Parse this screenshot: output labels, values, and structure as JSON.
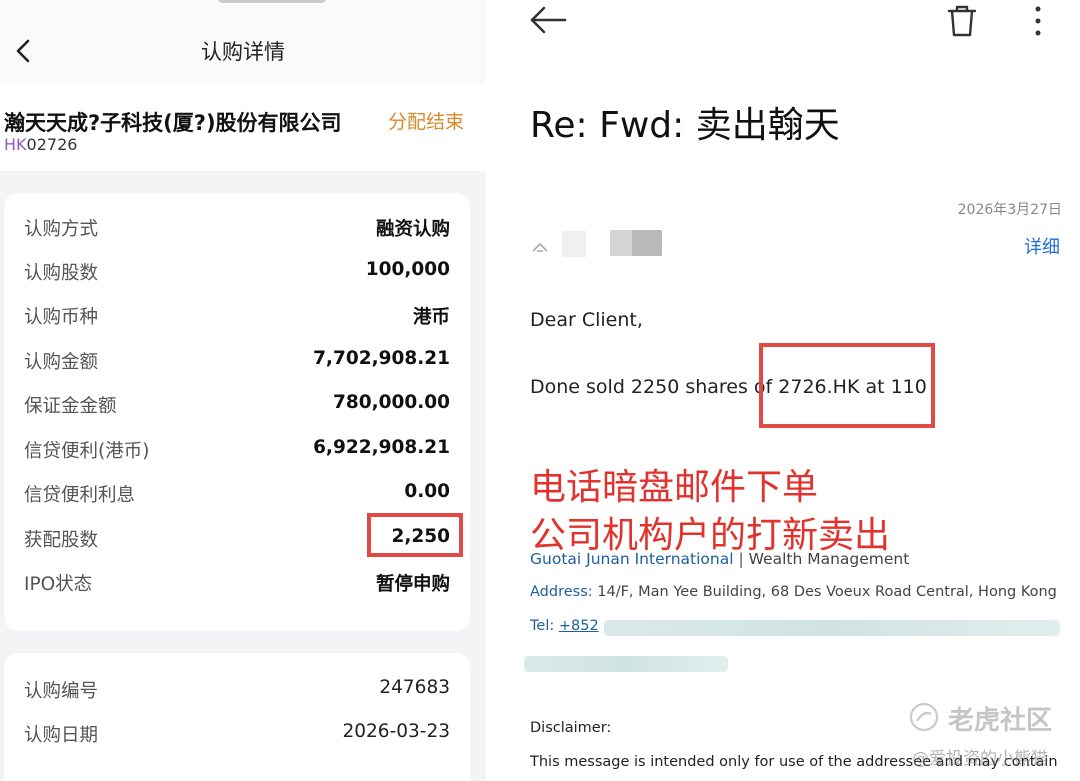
{
  "left": {
    "header_title": "认购详情",
    "stock_name": "瀚天天成?子科技(厦?)股份有限公司",
    "stock_market": "HK",
    "stock_code": "02726",
    "status": "分配结束",
    "details": [
      {
        "label": "认购方式",
        "value": "融资认购"
      },
      {
        "label": "认购股数",
        "value": "100,000"
      },
      {
        "label": "认购币种",
        "value": "港币"
      },
      {
        "label": "认购金额",
        "value": "7,702,908.21"
      },
      {
        "label": "保证金金额",
        "value": "780,000.00"
      },
      {
        "label": "信贷便利(港币)",
        "value": "6,922,908.21"
      },
      {
        "label": "信贷便利利息",
        "value": "0.00"
      },
      {
        "label": "获配股数",
        "value": "2,250"
      },
      {
        "label": "IPO状态",
        "value": "暂停申购"
      }
    ],
    "extra": [
      {
        "label": "认购编号",
        "value": "247683"
      },
      {
        "label": "认购日期",
        "value": "2026-03-23"
      }
    ]
  },
  "email": {
    "subject": "Re: Fwd: 卖出翰天",
    "date": "2026年3月27日",
    "detail_link": "详细",
    "greeting": "Dear Client,",
    "body": "Done sold 2250 shares of 2726.HK at 110",
    "annotation_line1": "电话暗盘邮件下单",
    "annotation_line2": "公司机构户的打新卖出",
    "firm": "Guotai Junan International",
    "separator": "|",
    "division": "Wealth Management",
    "address_label": "Address:",
    "address": "14/F, Man Yee Building, 68 Des Voeux Road Central, Hong Kong",
    "tel_label": "Tel:",
    "tel": "+852",
    "disclaimer_title": "Disclaimer:",
    "disclaimer_body": "This message is intended only for use of the addressee and may contain"
  },
  "watermark": {
    "site": "老虎社区",
    "user": "@爱投资的小熊猫"
  },
  "colors": {
    "highlight": "#e24a47",
    "status_orange": "#d9892c",
    "link_blue": "#1e6fd9",
    "firm_blue": "#1e5fa0"
  }
}
